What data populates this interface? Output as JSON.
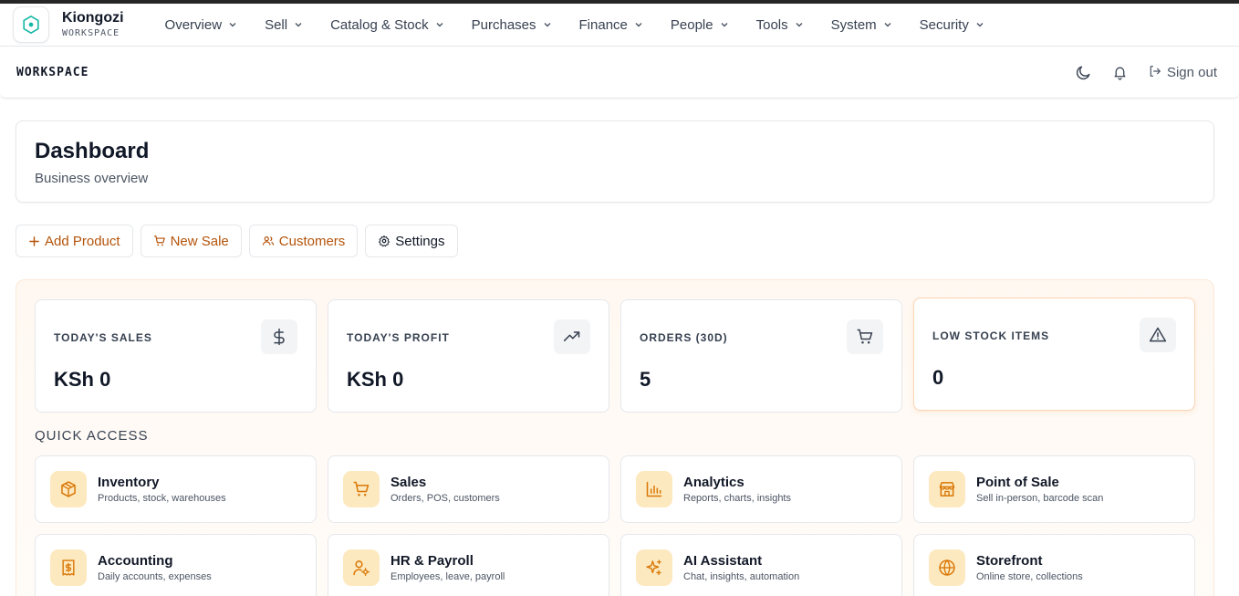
{
  "brand": {
    "name": "Kiongozi",
    "subtitle": "WORKSPACE"
  },
  "nav": [
    {
      "label": "Overview"
    },
    {
      "label": "Sell"
    },
    {
      "label": "Catalog & Stock"
    },
    {
      "label": "Purchases"
    },
    {
      "label": "Finance"
    },
    {
      "label": "People"
    },
    {
      "label": "Tools"
    },
    {
      "label": "System"
    },
    {
      "label": "Security"
    }
  ],
  "subheader": {
    "workspace_label": "WORKSPACE",
    "theme_icon": "moon-icon",
    "notifications_icon": "bell-icon",
    "signout_label": "Sign out"
  },
  "page": {
    "title": "Dashboard",
    "subtitle": "Business overview"
  },
  "actions": [
    {
      "label": "Add Product",
      "icon": "plus-icon"
    },
    {
      "label": "New Sale",
      "icon": "cart-icon"
    },
    {
      "label": "Customers",
      "icon": "users-icon"
    },
    {
      "label": "Settings",
      "icon": "gear-icon"
    }
  ],
  "stats": [
    {
      "label": "TODAY'S SALES",
      "value": "KSh 0",
      "icon": "dollar-icon"
    },
    {
      "label": "TODAY'S PROFIT",
      "value": "KSh 0",
      "icon": "trending-up-icon"
    },
    {
      "label": "ORDERS (30D)",
      "value": "5",
      "icon": "cart-icon"
    },
    {
      "label": "LOW STOCK ITEMS",
      "value": "0",
      "icon": "alert-triangle-icon"
    }
  ],
  "quick_access": {
    "title": "QUICK ACCESS",
    "items": [
      {
        "title": "Inventory",
        "subtitle": "Products, stock, warehouses",
        "icon": "box-icon"
      },
      {
        "title": "Sales",
        "subtitle": "Orders, POS, customers",
        "icon": "cart-icon"
      },
      {
        "title": "Analytics",
        "subtitle": "Reports, charts, insights",
        "icon": "bar-chart-icon"
      },
      {
        "title": "Point of Sale",
        "subtitle": "Sell in-person, barcode scan",
        "icon": "store-icon"
      },
      {
        "title": "Accounting",
        "subtitle": "Daily accounts, expenses",
        "icon": "receipt-dollar-icon"
      },
      {
        "title": "HR & Payroll",
        "subtitle": "Employees, leave, payroll",
        "icon": "user-cog-icon"
      },
      {
        "title": "AI Assistant",
        "subtitle": "Chat, insights, automation",
        "icon": "sparkles-icon"
      },
      {
        "title": "Storefront",
        "subtitle": "Online store, collections",
        "icon": "globe-icon"
      }
    ]
  },
  "colors": {
    "accent": "#b45309",
    "icon_accent": "#d97706",
    "tile_icon_bg": "#fde9bf",
    "brand_teal": "#14b8a6"
  }
}
